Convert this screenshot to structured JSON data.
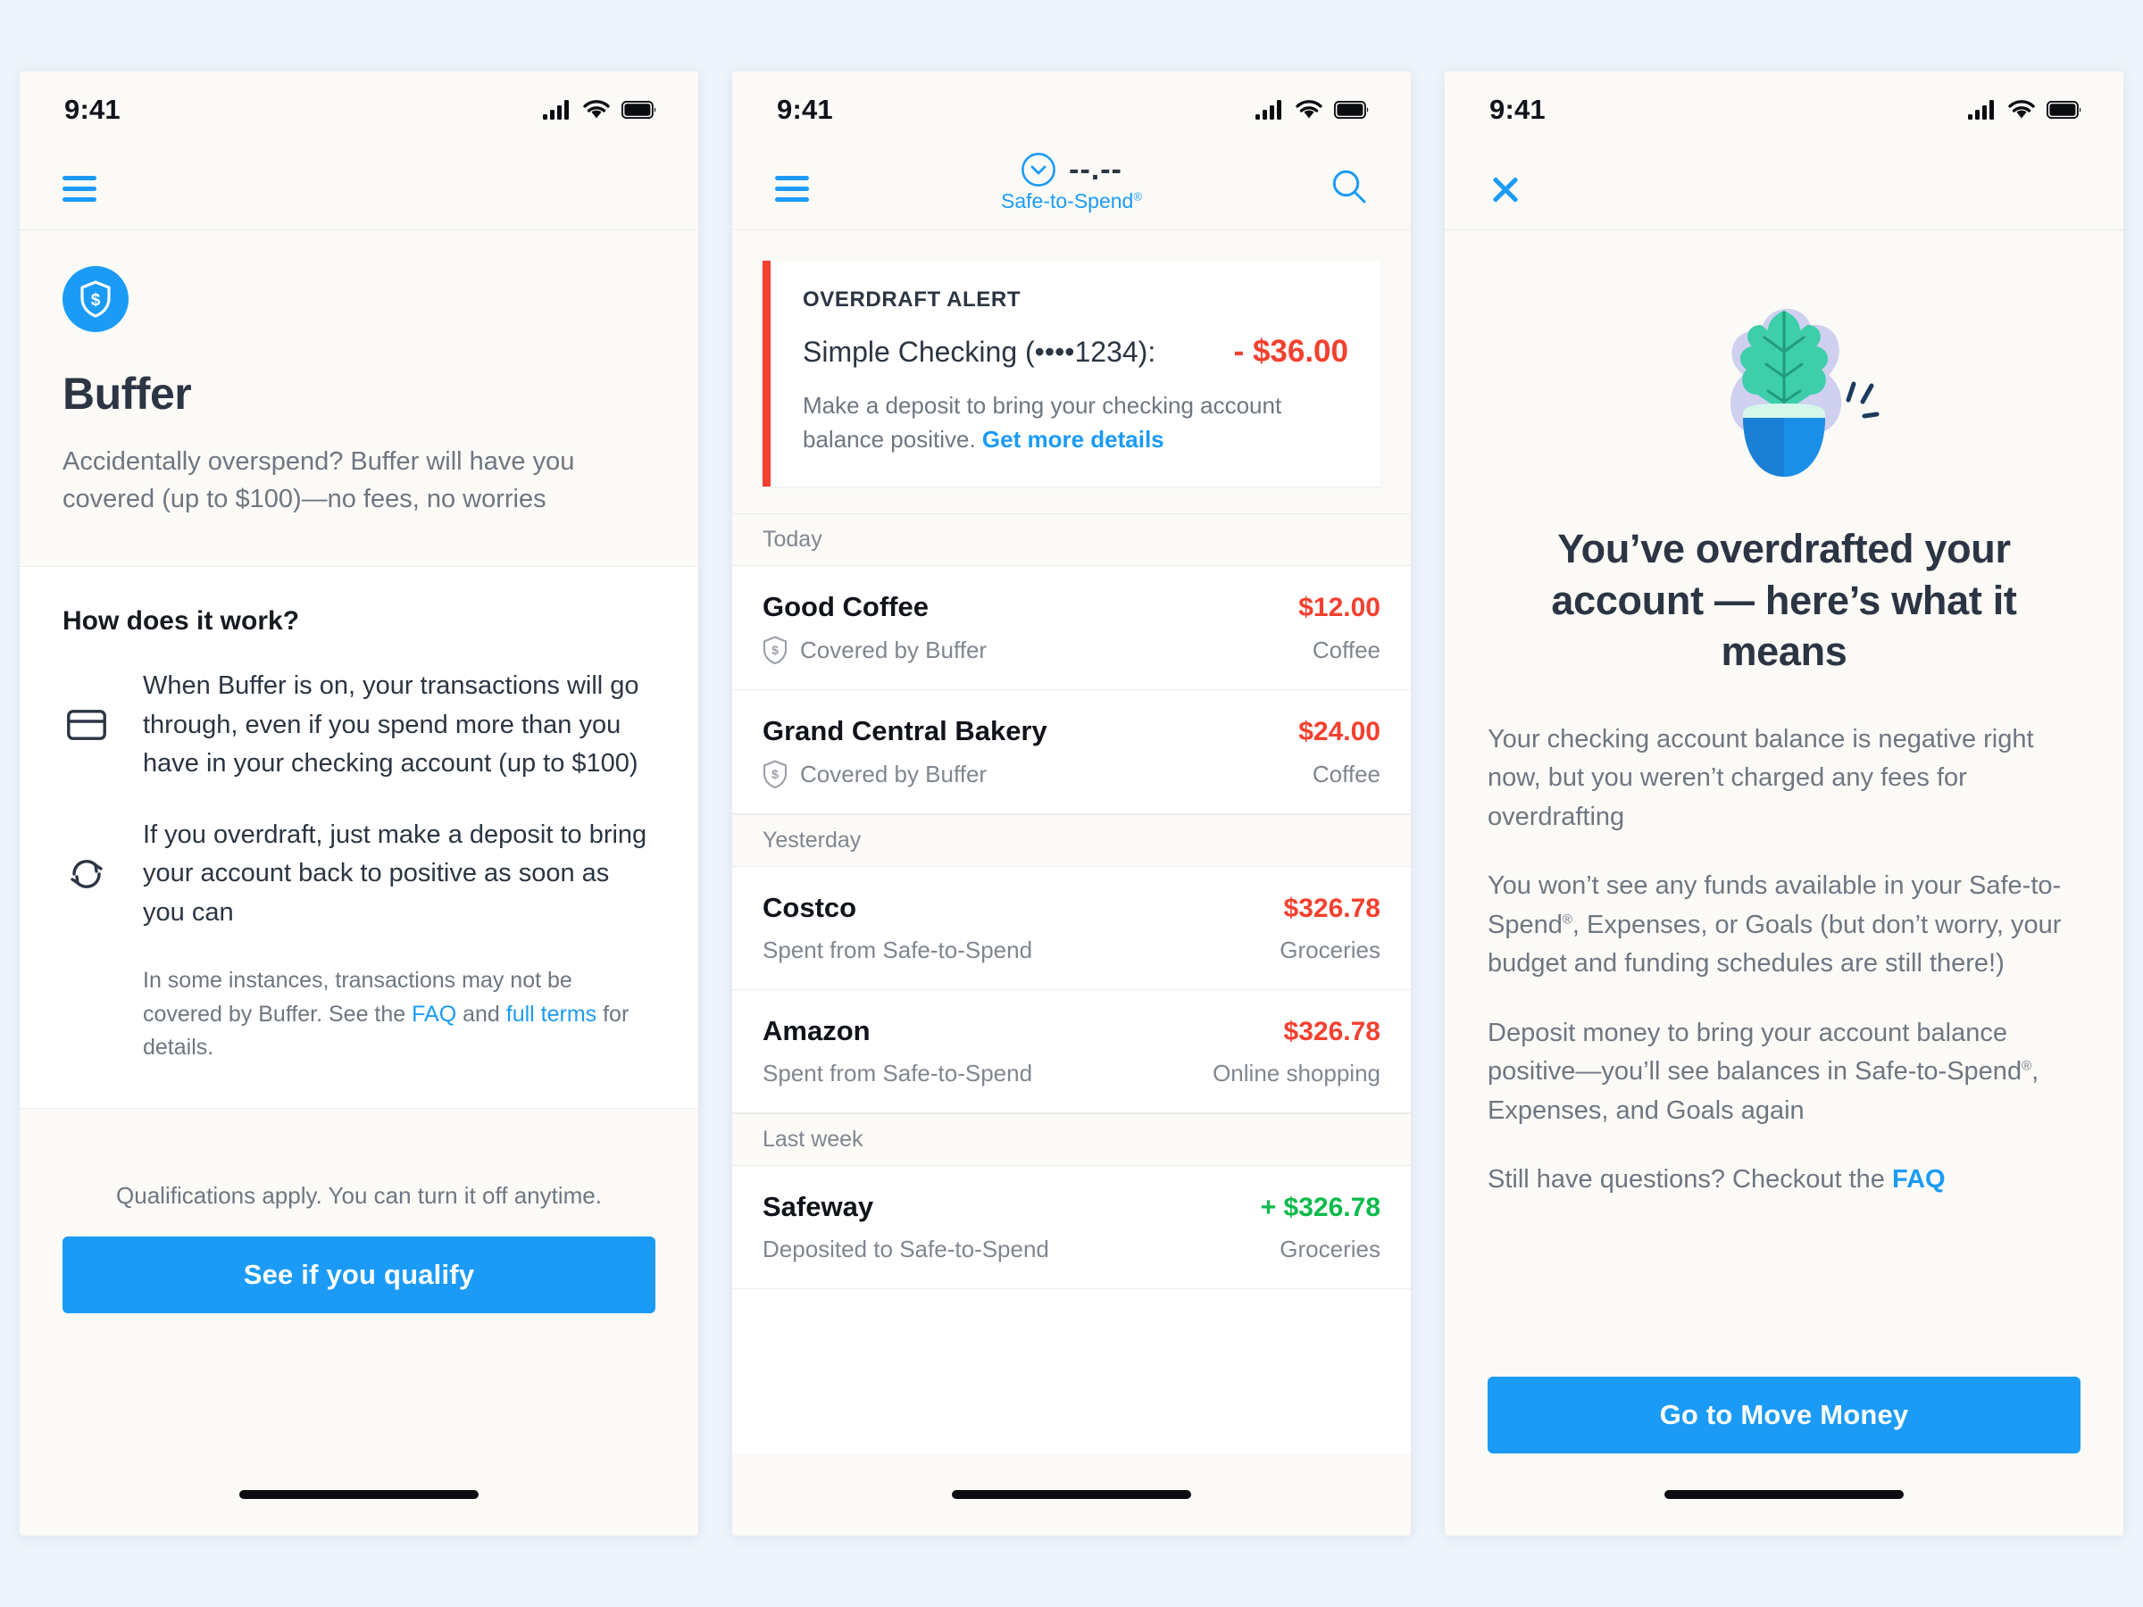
{
  "colors": {
    "accent": "#1b9bf5",
    "danger": "#f3402f",
    "positive": "#0dba4b",
    "text_dark": "#2b3543",
    "text_muted": "#6e7681",
    "canvas": "#eef4fb",
    "card": "#fbfaf7"
  },
  "panel1": {
    "status": {
      "time": "9:41",
      "signal": "cellular-signal-icon",
      "wifi": "wifi-icon",
      "battery": "battery-full-icon"
    },
    "nav": {
      "menu_icon": "hamburger-menu-icon"
    },
    "hero": {
      "badge_icon": "shield-dollar-icon",
      "title": "Buffer",
      "subtitle": "Accidentally overspend? Buffer will have you covered (up to $100)—no fees, no worries"
    },
    "how": {
      "heading": "How does it work?",
      "features": [
        {
          "icon": "credit-card-icon",
          "text": "When Buffer is on, your transactions will go through, even if you spend more than you have in your checking account (up to $100)"
        },
        {
          "icon": "refresh-sync-icon",
          "text": "If you overdraft, just make a deposit to bring your account back to positive as soon as you can"
        }
      ],
      "fineprint": {
        "part1": "In some instances, transactions may not be covered by Buffer. See the ",
        "link1": "FAQ",
        "part2": " and ",
        "link2": "full terms",
        "part3": " for details."
      }
    },
    "cta": {
      "note": "Qualifications apply. You can turn it off anytime.",
      "button": "See if you qualify"
    }
  },
  "panel2": {
    "status": {
      "time": "9:41",
      "signal": "cellular-signal-icon",
      "wifi": "wifi-icon",
      "battery": "battery-full-icon"
    },
    "nav": {
      "menu_icon": "hamburger-menu-icon",
      "chevron_icon": "chevron-down-circle-icon",
      "balance": "--.--",
      "balance_label": "Safe-to-Spend",
      "balance_label_mark": "®",
      "search_icon": "search-icon"
    },
    "alert": {
      "kicker": "OVERDRAFT ALERT",
      "account": "Simple Checking (••••1234):",
      "amount": "- $36.00",
      "desc_part1": "Make a deposit to bring your checking account balance positive. ",
      "desc_link": "Get more details"
    },
    "groups": [
      {
        "label": "Today",
        "transactions": [
          {
            "name": "Good Coffee",
            "amount": "$12.00",
            "type": "debit",
            "source": "Covered by Buffer",
            "source_icon": "shield-dollar-outline-icon",
            "category": "Coffee"
          },
          {
            "name": "Grand Central Bakery",
            "amount": "$24.00",
            "type": "debit",
            "source": "Covered by Buffer",
            "source_icon": "shield-dollar-outline-icon",
            "category": "Coffee"
          }
        ]
      },
      {
        "label": "Yesterday",
        "transactions": [
          {
            "name": "Costco",
            "amount": "$326.78",
            "type": "debit",
            "source": "Spent from Safe-to-Spend",
            "source_icon": "",
            "category": "Groceries"
          },
          {
            "name": "Amazon",
            "amount": "$326.78",
            "type": "debit",
            "source": "Spent from Safe-to-Spend",
            "source_icon": "",
            "category": "Online shopping"
          }
        ]
      },
      {
        "label": "Last week",
        "transactions": [
          {
            "name": "Safeway",
            "amount": "+ $326.78",
            "type": "credit",
            "source": "Deposited to Safe-to-Spend",
            "source_icon": "",
            "category": "Groceries"
          }
        ]
      }
    ]
  },
  "panel3": {
    "status": {
      "time": "9:41",
      "signal": "cellular-signal-icon",
      "wifi": "wifi-icon",
      "battery": "battery-full-icon"
    },
    "nav": {
      "close_icon": "close-x-icon"
    },
    "illustration": "potted-plant-illustration",
    "title": "You’ve overdrafted your account — here’s what it means",
    "paragraphs": {
      "p1": "Your checking account balance is negative right now, but you weren’t charged any fees for overdrafting",
      "p2_a": "You won’t see any funds available in your Safe-to-Spend",
      "p2_mark": "®",
      "p2_b": ", Expenses, or Goals (but don’t worry, your budget and funding schedules are still there!)",
      "p3_a": "Deposit money to bring your account balance positive—you’ll see balances in Safe-to-Spend",
      "p3_mark": "®",
      "p3_b": ", Expenses, and Goals again",
      "p4_a": "Still have questions? Checkout the ",
      "p4_link": "FAQ"
    },
    "cta": {
      "button": "Go to Move Money"
    }
  }
}
